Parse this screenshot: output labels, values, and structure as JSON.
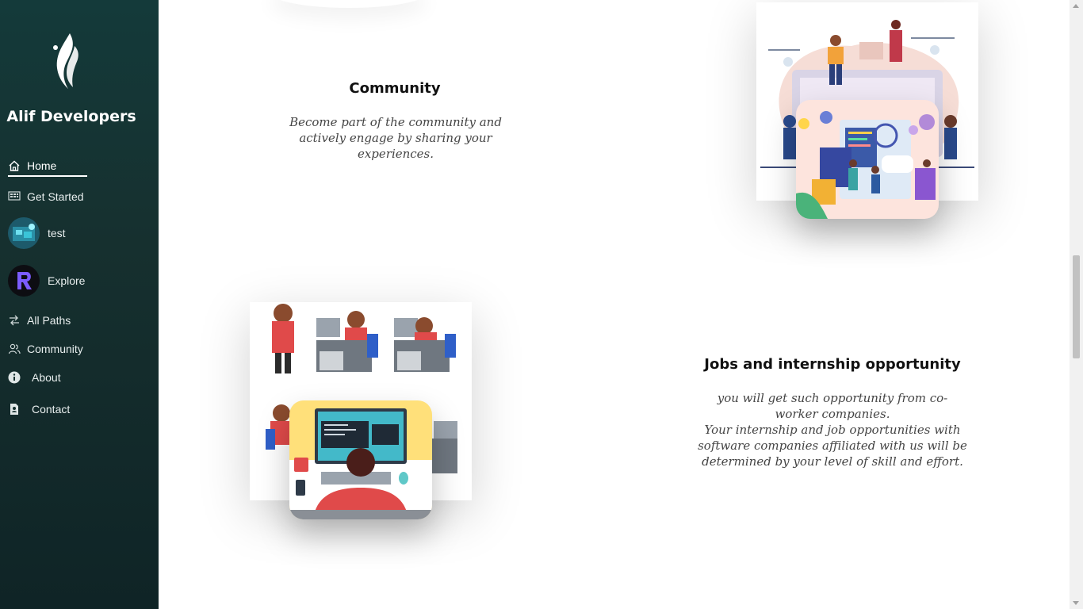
{
  "sidebar": {
    "brand": "Alif Developers",
    "items": [
      {
        "label": "Home",
        "icon": "home-icon"
      },
      {
        "label": "Get Started",
        "icon": "grid-icon"
      },
      {
        "label": "test",
        "icon": "avatar"
      },
      {
        "label": "Explore",
        "icon": "r-logo"
      },
      {
        "label": "All Paths",
        "icon": "paths-icon"
      },
      {
        "label": "Community",
        "icon": "community-icon"
      },
      {
        "label": "About",
        "icon": "info-icon"
      },
      {
        "label": "Contact",
        "icon": "contact-icon"
      }
    ]
  },
  "sections": {
    "community": {
      "title": "Community",
      "text": "Become part of the community and actively engage by sharing your experiences."
    },
    "jobs": {
      "title": "Jobs and internship opportunity",
      "text1": "you will get such opportunity from co-worker companies.",
      "text2": "Your internship and job opportunities with software companies affiliated with us will be determined by your level of skill and effort."
    }
  },
  "colors": {
    "sidebar_top": "#143a3a",
    "sidebar_bottom": "#0f2426",
    "accent_purple": "#6a4bd8"
  }
}
